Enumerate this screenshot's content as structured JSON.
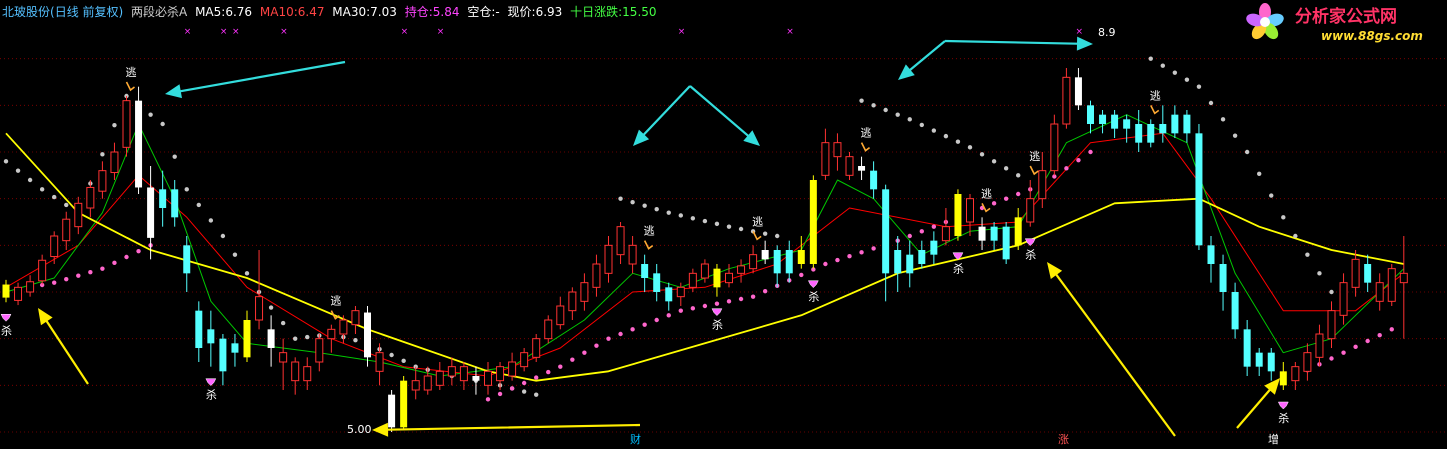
{
  "header": {
    "stock": "北玻股份",
    "period": "(日线 前复权)",
    "indicator": "两段必杀A",
    "ma5_label": "MA5:",
    "ma5_value": "6.76",
    "ma10_label": "MA10:",
    "ma10_value": "6.47",
    "ma30_label": "MA30:",
    "ma30_value": "7.03",
    "hold_label": "持仓:",
    "hold_value": "5.84",
    "empty_label": "空仓:",
    "empty_value": "-",
    "price_label": "现价:",
    "price_value": "6.93",
    "tenday_label": "十日涨跌:",
    "tenday_value": "15.50"
  },
  "logo": {
    "title": "分析家公式网",
    "url": "www.88gs.com"
  },
  "labels": {
    "sell": "杀",
    "escape": "逃",
    "low_price": "5.00",
    "high_price": "8.9",
    "info_cai": "财",
    "info_zhang": "涨",
    "info_zeng": "增"
  },
  "colors": {
    "background": "#000000",
    "up": "#ff3232",
    "down": "#54ffff",
    "ma5": "#ffffff",
    "ma10": "#ffff00",
    "ma30": "#ff00ff",
    "yellow_ma": "#ffff00",
    "green_ma": "#00c800",
    "red_ma": "#ff0000",
    "dot_white": "#c8c8c8",
    "dot_pink": "#ff66cc",
    "arrow_cyan": "#33dddd",
    "arrow_yellow": "#ffee00",
    "grid": "#8b0000"
  },
  "chart_data": {
    "type": "candlestick",
    "title": "北玻股份 两段必杀A",
    "ylim": [
      4.85,
      9.35
    ],
    "y_grid": [
      9.0,
      8.5,
      8.0,
      7.5,
      7.0,
      6.5,
      6.0,
      5.5,
      5.0
    ],
    "annotations": {
      "low": 5.0,
      "high": 8.9
    },
    "candles": [
      [
        0,
        6.44,
        6.58,
        6.39,
        6.63,
        "Y"
      ],
      [
        1,
        6.55,
        6.41,
        6.36,
        6.6,
        "U"
      ],
      [
        2,
        6.5,
        6.61,
        6.45,
        6.68,
        "U"
      ],
      [
        3,
        6.62,
        6.84,
        6.58,
        6.9,
        "U"
      ],
      [
        4,
        6.88,
        7.1,
        6.8,
        7.15,
        "U"
      ],
      [
        5,
        7.05,
        7.28,
        6.95,
        7.36,
        "U"
      ],
      [
        6,
        7.2,
        7.45,
        7.12,
        7.52,
        "U"
      ],
      [
        7,
        7.4,
        7.62,
        7.3,
        7.7,
        "U"
      ],
      [
        8,
        7.58,
        7.8,
        7.5,
        7.9,
        "U"
      ],
      [
        9,
        7.78,
        8.0,
        7.7,
        8.1,
        "U"
      ],
      [
        10,
        8.05,
        8.55,
        7.95,
        8.6,
        "U"
      ],
      [
        11,
        8.55,
        7.62,
        7.55,
        8.7,
        "W"
      ],
      [
        12,
        7.62,
        7.08,
        6.85,
        7.85,
        "W"
      ],
      [
        13,
        7.4,
        7.6,
        7.2,
        7.8,
        "D"
      ],
      [
        14,
        7.6,
        7.3,
        7.2,
        7.7,
        "D"
      ],
      [
        15,
        7.0,
        6.7,
        6.5,
        7.1,
        "D"
      ],
      [
        16,
        6.3,
        5.9,
        5.75,
        6.4,
        "D"
      ],
      [
        17,
        6.1,
        5.95,
        5.7,
        6.3,
        "D"
      ],
      [
        18,
        6.0,
        5.65,
        5.5,
        6.05,
        "D"
      ],
      [
        19,
        5.85,
        5.95,
        5.7,
        6.05,
        "D"
      ],
      [
        20,
        5.8,
        6.2,
        5.75,
        6.3,
        "Y"
      ],
      [
        21,
        6.2,
        6.45,
        6.1,
        6.95,
        "U"
      ],
      [
        22,
        6.1,
        5.9,
        5.7,
        6.25,
        "W"
      ],
      [
        23,
        5.85,
        5.75,
        5.45,
        6.0,
        "U"
      ],
      [
        24,
        5.75,
        5.55,
        5.4,
        5.8,
        "U"
      ],
      [
        25,
        5.55,
        5.7,
        5.45,
        5.8,
        "U"
      ],
      [
        26,
        5.75,
        6.0,
        5.65,
        6.05,
        "U"
      ],
      [
        27,
        6.0,
        6.1,
        5.85,
        6.15,
        "U"
      ],
      [
        28,
        6.05,
        6.2,
        5.95,
        6.25,
        "U"
      ],
      [
        29,
        6.15,
        6.3,
        6.05,
        6.35,
        "U"
      ],
      [
        30,
        6.28,
        5.8,
        5.7,
        6.35,
        "W"
      ],
      [
        31,
        5.85,
        5.65,
        5.5,
        5.95,
        "U"
      ],
      [
        32,
        5.4,
        5.05,
        5.0,
        5.45,
        "W"
      ],
      [
        33,
        5.05,
        5.55,
        5.02,
        5.6,
        "Y"
      ],
      [
        34,
        5.55,
        5.45,
        5.35,
        5.7,
        "U"
      ],
      [
        35,
        5.45,
        5.6,
        5.4,
        5.7,
        "U"
      ],
      [
        36,
        5.5,
        5.65,
        5.45,
        5.75,
        "U"
      ],
      [
        37,
        5.6,
        5.7,
        5.5,
        5.8,
        "U"
      ],
      [
        38,
        5.7,
        5.55,
        5.45,
        5.75,
        "U"
      ],
      [
        39,
        5.55,
        5.6,
        5.4,
        5.7,
        "W"
      ],
      [
        40,
        5.5,
        5.65,
        5.4,
        5.75,
        "U"
      ],
      [
        41,
        5.55,
        5.7,
        5.45,
        5.75,
        "U"
      ],
      [
        42,
        5.6,
        5.75,
        5.55,
        5.85,
        "U"
      ],
      [
        43,
        5.7,
        5.85,
        5.65,
        5.9,
        "U"
      ],
      [
        44,
        5.8,
        6.0,
        5.75,
        6.05,
        "U"
      ],
      [
        45,
        6.0,
        6.2,
        5.95,
        6.25,
        "U"
      ],
      [
        46,
        6.15,
        6.35,
        6.1,
        6.45,
        "U"
      ],
      [
        47,
        6.3,
        6.5,
        6.2,
        6.55,
        "U"
      ],
      [
        48,
        6.4,
        6.6,
        6.3,
        6.7,
        "U"
      ],
      [
        49,
        6.55,
        6.8,
        6.45,
        6.9,
        "U"
      ],
      [
        50,
        6.7,
        7.0,
        6.6,
        7.1,
        "U"
      ],
      [
        51,
        6.9,
        7.2,
        6.8,
        7.25,
        "U"
      ],
      [
        52,
        7.0,
        6.8,
        6.7,
        7.1,
        "U"
      ],
      [
        53,
        6.8,
        6.65,
        6.5,
        6.9,
        "D"
      ],
      [
        54,
        6.7,
        6.5,
        6.4,
        6.8,
        "D"
      ],
      [
        55,
        6.55,
        6.4,
        6.3,
        6.6,
        "D"
      ],
      [
        56,
        6.45,
        6.55,
        6.35,
        6.6,
        "U"
      ],
      [
        57,
        6.55,
        6.7,
        6.5,
        6.75,
        "U"
      ],
      [
        58,
        6.65,
        6.8,
        6.6,
        6.85,
        "U"
      ],
      [
        59,
        6.75,
        6.55,
        6.45,
        6.8,
        "Y"
      ],
      [
        60,
        6.6,
        6.7,
        6.55,
        6.8,
        "U"
      ],
      [
        61,
        6.7,
        6.78,
        6.6,
        6.85,
        "U"
      ],
      [
        62,
        6.75,
        6.9,
        6.7,
        7.0,
        "U"
      ],
      [
        63,
        6.85,
        6.95,
        6.8,
        7.05,
        "W"
      ],
      [
        64,
        6.95,
        6.7,
        6.55,
        7.0,
        "D"
      ],
      [
        65,
        6.7,
        6.95,
        6.6,
        7.05,
        "D"
      ],
      [
        66,
        6.95,
        6.8,
        6.75,
        7.1,
        "Y"
      ],
      [
        67,
        6.8,
        7.7,
        6.75,
        7.75,
        "Y"
      ],
      [
        68,
        7.75,
        8.1,
        7.7,
        8.25,
        "U"
      ],
      [
        69,
        8.1,
        7.95,
        7.8,
        8.2,
        "U"
      ],
      [
        70,
        7.95,
        7.75,
        7.7,
        8.0,
        "U"
      ],
      [
        71,
        7.85,
        7.8,
        7.7,
        7.95,
        "W"
      ],
      [
        72,
        7.8,
        7.6,
        7.5,
        7.9,
        "D"
      ],
      [
        73,
        7.6,
        6.7,
        6.4,
        7.65,
        "D"
      ],
      [
        74,
        6.7,
        6.95,
        6.5,
        7.1,
        "D"
      ],
      [
        75,
        6.9,
        6.7,
        6.55,
        7.05,
        "D"
      ],
      [
        76,
        6.8,
        6.95,
        6.75,
        7.05,
        "D"
      ],
      [
        77,
        6.9,
        7.05,
        6.8,
        7.15,
        "D"
      ],
      [
        78,
        7.05,
        7.2,
        7.0,
        7.4,
        "U"
      ],
      [
        79,
        7.1,
        7.55,
        7.05,
        7.6,
        "Y"
      ],
      [
        80,
        7.5,
        7.25,
        7.1,
        7.55,
        "U"
      ],
      [
        81,
        7.2,
        7.05,
        6.95,
        7.3,
        "W"
      ],
      [
        82,
        7.05,
        7.2,
        6.95,
        7.25,
        "D"
      ],
      [
        83,
        7.2,
        6.85,
        6.8,
        7.25,
        "D"
      ],
      [
        84,
        7.0,
        7.3,
        6.95,
        7.4,
        "Y"
      ],
      [
        85,
        7.25,
        7.5,
        7.2,
        7.7,
        "U"
      ],
      [
        86,
        7.5,
        7.8,
        7.4,
        8.0,
        "U"
      ],
      [
        87,
        7.8,
        8.3,
        7.75,
        8.4,
        "U"
      ],
      [
        88,
        8.3,
        8.8,
        8.25,
        8.9,
        "U"
      ],
      [
        89,
        8.8,
        8.5,
        8.45,
        8.9,
        "W"
      ],
      [
        90,
        8.5,
        8.3,
        8.2,
        8.55,
        "D"
      ],
      [
        91,
        8.3,
        8.4,
        8.2,
        8.45,
        "D"
      ],
      [
        92,
        8.4,
        8.25,
        8.15,
        8.45,
        "D"
      ],
      [
        93,
        8.25,
        8.35,
        8.1,
        8.4,
        "D"
      ],
      [
        94,
        8.3,
        8.1,
        8.0,
        8.45,
        "D"
      ],
      [
        95,
        8.1,
        8.3,
        8.05,
        8.35,
        "D"
      ],
      [
        96,
        8.3,
        8.2,
        8.1,
        8.5,
        "D"
      ],
      [
        97,
        8.2,
        8.4,
        8.15,
        8.5,
        "D"
      ],
      [
        98,
        8.4,
        8.2,
        8.1,
        8.45,
        "D"
      ],
      [
        99,
        8.2,
        7.0,
        6.95,
        8.3,
        "D"
      ],
      [
        100,
        7.0,
        6.8,
        6.6,
        7.1,
        "D"
      ],
      [
        101,
        6.8,
        6.5,
        6.3,
        6.9,
        "D"
      ],
      [
        102,
        6.5,
        6.1,
        6.0,
        6.6,
        "D"
      ],
      [
        103,
        6.1,
        5.7,
        5.6,
        6.2,
        "D"
      ],
      [
        104,
        5.7,
        5.85,
        5.6,
        5.9,
        "D"
      ],
      [
        105,
        5.85,
        5.65,
        5.55,
        5.9,
        "D"
      ],
      [
        106,
        5.65,
        5.5,
        5.45,
        5.75,
        "Y"
      ],
      [
        107,
        5.55,
        5.7,
        5.45,
        5.75,
        "U"
      ],
      [
        108,
        5.65,
        5.85,
        5.55,
        5.95,
        "U"
      ],
      [
        109,
        5.8,
        6.05,
        5.7,
        6.15,
        "U"
      ],
      [
        110,
        6.0,
        6.3,
        5.9,
        6.4,
        "U"
      ],
      [
        111,
        6.25,
        6.6,
        6.15,
        6.7,
        "U"
      ],
      [
        112,
        6.55,
        6.85,
        6.45,
        6.95,
        "U"
      ],
      [
        113,
        6.8,
        6.6,
        6.5,
        6.9,
        "D"
      ],
      [
        114,
        6.6,
        6.4,
        6.3,
        6.7,
        "U"
      ],
      [
        115,
        6.4,
        6.75,
        6.35,
        6.8,
        "U"
      ],
      [
        116,
        6.7,
        6.6,
        6.0,
        7.1,
        "U"
      ]
    ],
    "ma_yellow": [
      [
        0,
        8.2
      ],
      [
        6,
        7.35
      ],
      [
        12,
        6.95
      ],
      [
        20,
        6.65
      ],
      [
        30,
        6.1
      ],
      [
        40,
        5.65
      ],
      [
        44,
        5.55
      ],
      [
        50,
        5.65
      ],
      [
        58,
        5.95
      ],
      [
        66,
        6.25
      ],
      [
        74,
        6.7
      ],
      [
        84,
        7.0
      ],
      [
        92,
        7.45
      ],
      [
        99,
        7.5
      ],
      [
        104,
        7.2
      ],
      [
        110,
        6.95
      ],
      [
        116,
        6.8
      ]
    ],
    "ma_green": [
      [
        0,
        6.5
      ],
      [
        4,
        6.65
      ],
      [
        8,
        7.35
      ],
      [
        11,
        8.3
      ],
      [
        14,
        7.5
      ],
      [
        17,
        6.4
      ],
      [
        20,
        5.95
      ],
      [
        26,
        5.85
      ],
      [
        31,
        5.75
      ],
      [
        36,
        5.6
      ],
      [
        42,
        5.7
      ],
      [
        48,
        6.2
      ],
      [
        52,
        6.7
      ],
      [
        56,
        6.55
      ],
      [
        60,
        6.75
      ],
      [
        66,
        6.95
      ],
      [
        69,
        7.7
      ],
      [
        72,
        7.5
      ],
      [
        76,
        6.9
      ],
      [
        80,
        7.15
      ],
      [
        84,
        7.2
      ],
      [
        88,
        8.1
      ],
      [
        93,
        8.4
      ],
      [
        98,
        8.1
      ],
      [
        102,
        6.7
      ],
      [
        106,
        5.85
      ],
      [
        110,
        6.0
      ],
      [
        116,
        6.75
      ]
    ],
    "ma_red": [
      [
        0,
        6.55
      ],
      [
        6,
        7.0
      ],
      [
        11,
        7.75
      ],
      [
        15,
        7.3
      ],
      [
        20,
        6.55
      ],
      [
        27,
        6.0
      ],
      [
        33,
        5.7
      ],
      [
        40,
        5.6
      ],
      [
        46,
        5.9
      ],
      [
        52,
        6.5
      ],
      [
        58,
        6.55
      ],
      [
        64,
        6.8
      ],
      [
        70,
        7.4
      ],
      [
        78,
        7.2
      ],
      [
        84,
        7.25
      ],
      [
        90,
        8.1
      ],
      [
        96,
        8.2
      ],
      [
        100,
        7.5
      ],
      [
        106,
        6.3
      ],
      [
        112,
        6.3
      ],
      [
        116,
        6.7
      ]
    ],
    "dots_white": [
      [
        0,
        7.9
      ],
      [
        3,
        7.6
      ],
      [
        6,
        7.35
      ],
      [
        10,
        8.6
      ],
      [
        13,
        8.3
      ],
      [
        15,
        7.6
      ],
      [
        18,
        7.1
      ],
      [
        21,
        6.5
      ],
      [
        24,
        6.0
      ],
      [
        27,
        6.05
      ],
      [
        30,
        5.95
      ],
      [
        34,
        5.7
      ],
      [
        37,
        5.6
      ],
      [
        41,
        5.5
      ],
      [
        44,
        5.4
      ],
      [
        51,
        7.5
      ],
      [
        55,
        7.35
      ],
      [
        60,
        7.2
      ],
      [
        64,
        7.1
      ],
      [
        71,
        8.55
      ],
      [
        75,
        8.35
      ],
      [
        80,
        8.05
      ],
      [
        84,
        7.75
      ],
      [
        95,
        9.0
      ],
      [
        99,
        8.7
      ],
      [
        103,
        8.0
      ],
      [
        106,
        7.3
      ],
      [
        110,
        6.5
      ]
    ],
    "dots_pink": [
      [
        0,
        6.5
      ],
      [
        4,
        6.6
      ],
      [
        8,
        6.75
      ],
      [
        12,
        7.0
      ],
      [
        40,
        5.35
      ],
      [
        46,
        5.7
      ],
      [
        50,
        6.0
      ],
      [
        56,
        6.3
      ],
      [
        62,
        6.45
      ],
      [
        68,
        6.8
      ],
      [
        74,
        7.05
      ],
      [
        80,
        7.35
      ],
      [
        86,
        7.65
      ],
      [
        90,
        8.0
      ],
      [
        107,
        5.6
      ],
      [
        111,
        5.85
      ],
      [
        115,
        6.1
      ]
    ],
    "sell_signals": [
      0,
      17,
      59,
      67,
      79,
      85,
      106
    ],
    "escape_signals": [
      10,
      27,
      53,
      62,
      71,
      81,
      85,
      95
    ]
  }
}
